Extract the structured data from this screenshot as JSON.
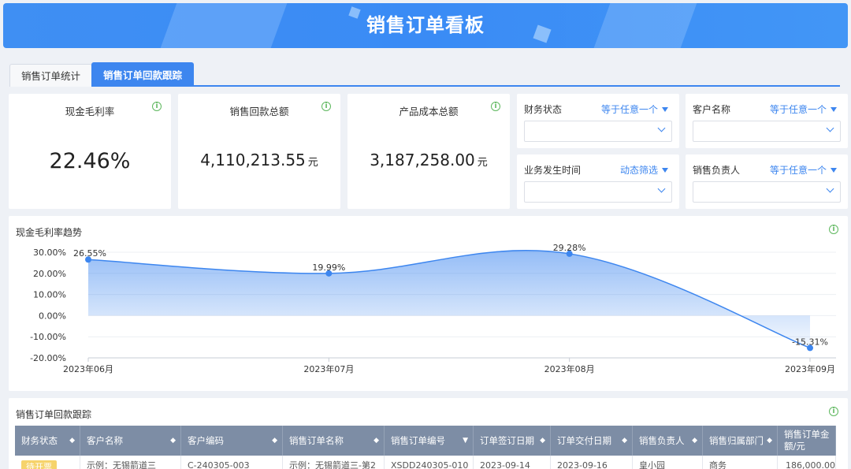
{
  "header": {
    "title": "销售订单看板"
  },
  "tabs": [
    {
      "label": "销售订单统计"
    },
    {
      "label": "销售订单回款跟踪"
    }
  ],
  "kpis": [
    {
      "label": "现金毛利率",
      "value": "22.46%",
      "unit": ""
    },
    {
      "label": "销售回款总额",
      "value": "4,110,213.55",
      "unit": "元"
    },
    {
      "label": "产品成本总额",
      "value": "3,187,258.00",
      "unit": "元"
    }
  ],
  "filters": [
    {
      "label": "财务状态",
      "operator": "等于任意一个",
      "value": ""
    },
    {
      "label": "客户名称",
      "operator": "等于任意一个",
      "value": ""
    },
    {
      "label": "业务发生时间",
      "operator": "动态筛选",
      "value": ""
    },
    {
      "label": "销售负责人",
      "operator": "等于任意一个",
      "value": ""
    }
  ],
  "trend": {
    "title": "现金毛利率趋势"
  },
  "chart_data": {
    "type": "area",
    "title": "现金毛利率趋势",
    "categories": [
      "2023年06月",
      "2023年07月",
      "2023年08月",
      "2023年09月"
    ],
    "values": [
      26.55,
      19.99,
      29.28,
      -15.31
    ],
    "data_labels": [
      "26.55%",
      "19.99%",
      "29.28%",
      "-15.31%"
    ],
    "y_ticks": [
      "30.00%",
      "20.00%",
      "10.00%",
      "0.00%",
      "-10.00%",
      "-20.00%"
    ],
    "ylim": [
      -20,
      30
    ],
    "grid": true,
    "color": "#3d86ef"
  },
  "tracking": {
    "title": "销售订单回款跟踪",
    "columns": [
      "财务状态",
      "客户名称",
      "客户编码",
      "销售订单名称",
      "销售订单编号",
      "订单签订日期",
      "订单交付日期",
      "销售负责人",
      "销售归属部门",
      "销售订单金额/元"
    ],
    "rows": [
      [
        "待开票",
        "示例：无锡箭道三",
        "C-240305-003",
        "示例：无锡箭道三-第2",
        "XSDD240305-010",
        "2023-09-14",
        "2023-09-16",
        "皇小园",
        "商务",
        "186,000.00"
      ]
    ]
  },
  "colors": {
    "accent": "#3d86ef",
    "header": "#3f8ff3",
    "table_header": "#7d8da5",
    "info": "#5fb85f"
  }
}
